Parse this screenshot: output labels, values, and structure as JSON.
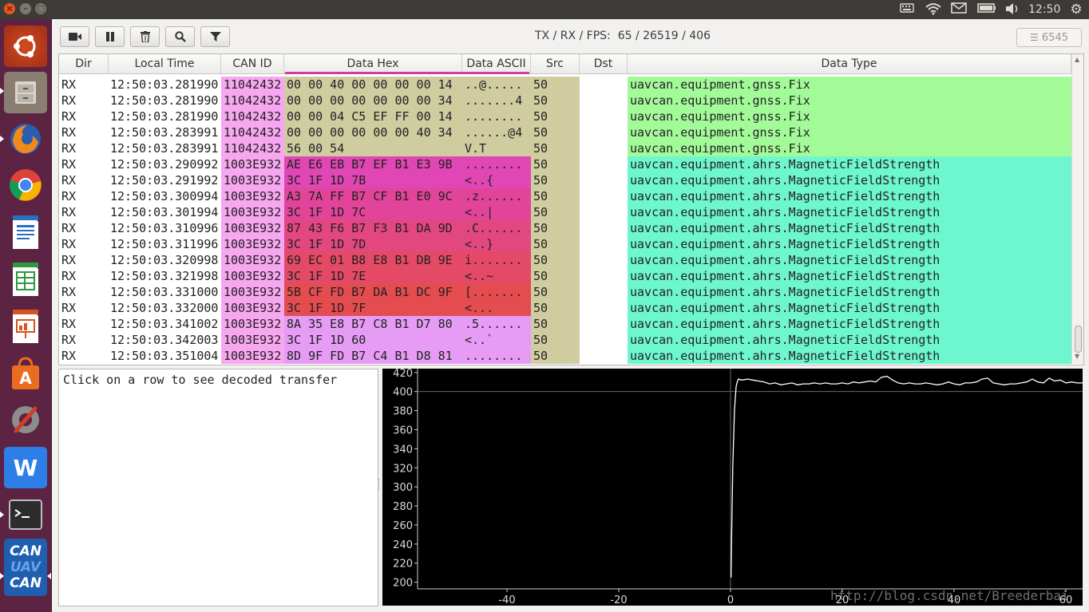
{
  "topbar": {
    "clock": "12:50",
    "indicators": [
      "keyboard-icon",
      "wifi-icon",
      "mail-icon",
      "battery-icon",
      "volume-icon",
      "settings-gear-icon"
    ]
  },
  "launcher": {
    "apps": [
      "ubuntu-dash",
      "files",
      "firefox",
      "chrome",
      "libreoffice-writer",
      "libreoffice-calc",
      "libreoffice-impress",
      "software-center",
      "system-settings",
      "wps-writer",
      "terminal",
      "uavcan-gui-tool"
    ],
    "uavcan_label_1": "CAN",
    "uavcan_label_2": "UAV",
    "uavcan_label_3": "CAN",
    "wps_label": "W"
  },
  "toolbar": {
    "buttons": [
      "record-icon",
      "pause-icon",
      "clear-icon",
      "search-icon",
      "filter-icon"
    ],
    "stats_label": "TX / RX / FPS:",
    "stats_value": "65 / 26519 / 406",
    "frame_count": "6545"
  },
  "table": {
    "columns": [
      "Dir",
      "Local Time",
      "CAN ID",
      "Data Hex",
      "Data ASCII",
      "Src",
      "Dst",
      "Data Type"
    ],
    "rows": [
      {
        "dir": "RX",
        "time": "12:50:03.281990",
        "id": "11042432",
        "hex": "00 00 40 00 00 00 00 14",
        "ascii": "..@.....",
        "src": "50",
        "dst": "",
        "type": "uavcan.equipment.gnss.Fix",
        "hex_color": "#cfcca0",
        "type_color": "#a3fa99"
      },
      {
        "dir": "RX",
        "time": "12:50:03.281990",
        "id": "11042432",
        "hex": "00 00 00 00 00 00 00 34",
        "ascii": ".......4",
        "src": "50",
        "dst": "",
        "type": "uavcan.equipment.gnss.Fix",
        "hex_color": "#cfcca0",
        "type_color": "#a3fa99"
      },
      {
        "dir": "RX",
        "time": "12:50:03.281990",
        "id": "11042432",
        "hex": "00 00 04 C5 EF FF 00 14",
        "ascii": "........",
        "src": "50",
        "dst": "",
        "type": "uavcan.equipment.gnss.Fix",
        "hex_color": "#cfcca0",
        "type_color": "#a3fa99"
      },
      {
        "dir": "RX",
        "time": "12:50:03.283991",
        "id": "11042432",
        "hex": "00 00 00 00 00 00 40 34",
        "ascii": "......@4",
        "src": "50",
        "dst": "",
        "type": "uavcan.equipment.gnss.Fix",
        "hex_color": "#cfcca0",
        "type_color": "#a3fa99"
      },
      {
        "dir": "RX",
        "time": "12:50:03.283991",
        "id": "11042432",
        "hex": "56 00 54",
        "ascii": "V.T",
        "src": "50",
        "dst": "",
        "type": "uavcan.equipment.gnss.Fix",
        "hex_color": "#cfcca0",
        "type_color": "#a3fa99"
      },
      {
        "dir": "RX",
        "time": "12:50:03.290992",
        "id": "1003E932",
        "hex": "AE E6 EB B7 EF B1 E3 9B",
        "ascii": "........",
        "src": "50",
        "dst": "",
        "type": "uavcan.equipment.ahrs.MagneticFieldStrength",
        "hex_color": "#e046b4",
        "type_color": "#6ef7cf"
      },
      {
        "dir": "RX",
        "time": "12:50:03.291992",
        "id": "1003E932",
        "hex": "3C 1F 1D 7B",
        "ascii": "<..{",
        "src": "50",
        "dst": "",
        "type": "uavcan.equipment.ahrs.MagneticFieldStrength",
        "hex_color": "#e046b4",
        "type_color": "#6ef7cf"
      },
      {
        "dir": "RX",
        "time": "12:50:03.300994",
        "id": "1003E932",
        "hex": "A3 7A FF B7 CF B1 E0 9C",
        "ascii": ".z......",
        "src": "50",
        "dst": "",
        "type": "uavcan.equipment.ahrs.MagneticFieldStrength",
        "hex_color": "#e2449a",
        "type_color": "#6ef7cf"
      },
      {
        "dir": "RX",
        "time": "12:50:03.301994",
        "id": "1003E932",
        "hex": "3C 1F 1D 7C",
        "ascii": "<..|",
        "src": "50",
        "dst": "",
        "type": "uavcan.equipment.ahrs.MagneticFieldStrength",
        "hex_color": "#e2449a",
        "type_color": "#6ef7cf"
      },
      {
        "dir": "RX",
        "time": "12:50:03.310996",
        "id": "1003E932",
        "hex": "87 43 F6 B7 F3 B1 DA 9D",
        "ascii": ".C......",
        "src": "50",
        "dst": "",
        "type": "uavcan.equipment.ahrs.MagneticFieldStrength",
        "hex_color": "#e34780",
        "type_color": "#6ef7cf"
      },
      {
        "dir": "RX",
        "time": "12:50:03.311996",
        "id": "1003E932",
        "hex": "3C 1F 1D 7D",
        "ascii": "<..}",
        "src": "50",
        "dst": "",
        "type": "uavcan.equipment.ahrs.MagneticFieldStrength",
        "hex_color": "#e34780",
        "type_color": "#6ef7cf"
      },
      {
        "dir": "RX",
        "time": "12:50:03.320998",
        "id": "1003E932",
        "hex": "69 EC 01 B8 E8 B1 DB 9E",
        "ascii": "i.......",
        "src": "50",
        "dst": "",
        "type": "uavcan.equipment.ahrs.MagneticFieldStrength",
        "hex_color": "#e44a66",
        "type_color": "#6ef7cf"
      },
      {
        "dir": "RX",
        "time": "12:50:03.321998",
        "id": "1003E932",
        "hex": "3C 1F 1D 7E",
        "ascii": "<..~",
        "src": "50",
        "dst": "",
        "type": "uavcan.equipment.ahrs.MagneticFieldStrength",
        "hex_color": "#e44a66",
        "type_color": "#6ef7cf"
      },
      {
        "dir": "RX",
        "time": "12:50:03.331000",
        "id": "1003E932",
        "hex": "5B CF FD B7 DA B1 DC 9F",
        "ascii": "[.......",
        "src": "50",
        "dst": "",
        "type": "uavcan.equipment.ahrs.MagneticFieldStrength",
        "hex_color": "#e44c50",
        "type_color": "#6ef7cf"
      },
      {
        "dir": "RX",
        "time": "12:50:03.332000",
        "id": "1003E932",
        "hex": "3C 1F 1D 7F",
        "ascii": "<...",
        "src": "50",
        "dst": "",
        "type": "uavcan.equipment.ahrs.MagneticFieldStrength",
        "hex_color": "#e44c50",
        "type_color": "#6ef7cf"
      },
      {
        "dir": "RX",
        "time": "12:50:03.341002",
        "id": "1003E932",
        "hex": "8A 35 E8 B7 C8 B1 D7 80",
        "ascii": ".5......",
        "src": "50",
        "dst": "",
        "type": "uavcan.equipment.ahrs.MagneticFieldStrength",
        "hex_color": "#e69cf5",
        "type_color": "#6ef7cf"
      },
      {
        "dir": "RX",
        "time": "12:50:03.342003",
        "id": "1003E932",
        "hex": "3C 1F 1D 60",
        "ascii": "<..`",
        "src": "50",
        "dst": "",
        "type": "uavcan.equipment.ahrs.MagneticFieldStrength",
        "hex_color": "#e69cf5",
        "type_color": "#6ef7cf"
      },
      {
        "dir": "RX",
        "time": "12:50:03.351004",
        "id": "1003E932",
        "hex": "8D 9F FD B7 C4 B1 D8 81",
        "ascii": "........",
        "src": "50",
        "dst": "",
        "type": "uavcan.equipment.ahrs.MagneticFieldStrength",
        "hex_color": "#e69cf5",
        "type_color": "#6ef7cf"
      }
    ]
  },
  "decoded": {
    "placeholder": "Click on a row to see decoded transfer"
  },
  "chart_data": {
    "type": "line",
    "title": "",
    "xlabel": "",
    "ylabel": "",
    "xlim": [
      -56,
      63
    ],
    "ylim": [
      193,
      424
    ],
    "xticks": [
      -40,
      -20,
      0,
      20,
      40,
      60
    ],
    "yticks": [
      200,
      220,
      240,
      260,
      280,
      300,
      320,
      340,
      360,
      380,
      400,
      420
    ],
    "grid": "zero-lines",
    "series": [
      {
        "color": "#ffffff",
        "x": [
          0.1,
          0.2,
          0.4,
          0.7,
          1,
          1.2,
          1.4,
          2,
          3,
          4,
          5,
          6,
          7,
          8,
          9,
          10,
          11,
          12,
          13,
          14,
          15,
          16,
          17,
          18,
          19,
          20,
          21,
          22,
          23,
          24,
          25,
          26,
          27,
          28,
          29,
          30,
          31,
          32,
          33,
          34,
          35,
          36,
          37,
          38,
          39,
          40,
          41,
          42,
          43,
          44,
          45,
          46,
          47,
          48,
          49,
          50,
          51,
          52,
          53,
          54,
          55,
          56,
          57,
          58,
          59,
          60,
          61,
          62,
          63
        ],
        "y": [
          205,
          250,
          320,
          380,
          405,
          410,
          413,
          412,
          413,
          412,
          411,
          410,
          408,
          409,
          407,
          408,
          409,
          407,
          408,
          408,
          409,
          408,
          409,
          408,
          408,
          409,
          408,
          410,
          409,
          410,
          411,
          410,
          415,
          416,
          412,
          409,
          408,
          409,
          408,
          408,
          409,
          408,
          407,
          408,
          410,
          408,
          407,
          409,
          409,
          410,
          413,
          414,
          409,
          408,
          407,
          408,
          408,
          409,
          410,
          413,
          410,
          409,
          414,
          411,
          412,
          409,
          410,
          409,
          409
        ]
      }
    ]
  },
  "watermark": "http://blog.csdn.net/Breederbai"
}
